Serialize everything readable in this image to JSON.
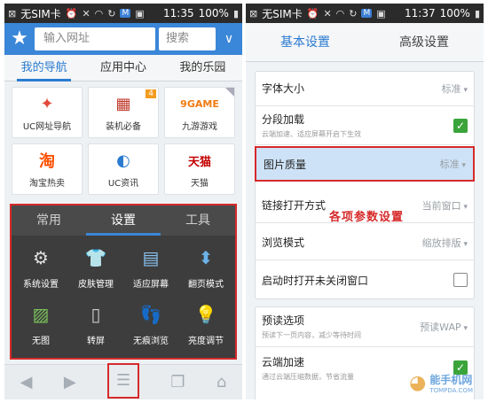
{
  "left": {
    "status": {
      "carrier": "无SIM卡",
      "time": "11:35",
      "battery": "100%"
    },
    "address_placeholder": "输入网址",
    "search_label": "搜索",
    "nav_tabs": [
      "我的导航",
      "应用中心",
      "我的乐园"
    ],
    "grid": [
      {
        "label": "UC网址导航",
        "icon": "compass-icon"
      },
      {
        "label": "装机必备",
        "icon": "apps-icon",
        "badge": "4"
      },
      {
        "label": "九游游戏",
        "icon": "game-icon",
        "logo": "9GAME"
      },
      {
        "label": "淘宝热卖",
        "icon": "taobao-icon",
        "logo": "淘"
      },
      {
        "label": "UC资讯",
        "icon": "news-icon"
      },
      {
        "label": "天猫",
        "icon": "tmall-icon",
        "logo": "天猫"
      }
    ],
    "menu": {
      "tabs": [
        "常用",
        "设置",
        "工具"
      ],
      "active_tab": "设置",
      "items": [
        {
          "label": "系统设置",
          "icon": "gear-icon"
        },
        {
          "label": "皮肤管理",
          "icon": "tshirt-icon"
        },
        {
          "label": "适应屏幕",
          "icon": "fit-screen-icon"
        },
        {
          "label": "翻页模式",
          "icon": "page-arrows-icon"
        },
        {
          "label": "无图",
          "icon": "no-image-icon"
        },
        {
          "label": "转屏",
          "icon": "rotate-screen-icon"
        },
        {
          "label": "无痕浏览",
          "icon": "footprint-icon"
        },
        {
          "label": "亮度调节",
          "icon": "bulb-icon"
        }
      ]
    },
    "bottom_nav": [
      "back-icon",
      "forward-icon",
      "menu-icon",
      "windows-icon",
      "home-icon"
    ]
  },
  "right": {
    "status": {
      "carrier": "无SIM卡",
      "time": "11:37",
      "battery": "100%"
    },
    "tabs": [
      "基本设置",
      "高级设置"
    ],
    "rows": [
      {
        "label": "字体大小",
        "value": "标准"
      },
      {
        "label": "分段加载",
        "sub": "云端加速、适应屏幕开启下生效",
        "checked": true
      },
      {
        "label": "图片质量",
        "value": "标准",
        "highlight": true
      },
      {
        "label": "链接打开方式",
        "value": "当前窗口"
      },
      {
        "label": "浏览模式",
        "value": "缩放排版"
      },
      {
        "label": "启动时打开未关闭窗口",
        "checked": false
      },
      {
        "label": "预读选项",
        "sub": "预读下一页内容，减少等待时间",
        "value": "预读WAP"
      },
      {
        "label": "云端加速",
        "sub": "通过云端压缩数据，节省流量",
        "checked": true
      }
    ],
    "annotation": "各项参数设置",
    "watermark": {
      "title": "能手机网",
      "sub": "TOMPDA.COM"
    }
  },
  "colors": {
    "accent": "#2a7bd0",
    "highlight_border": "#d62a2a",
    "check": "#3aa43a"
  }
}
